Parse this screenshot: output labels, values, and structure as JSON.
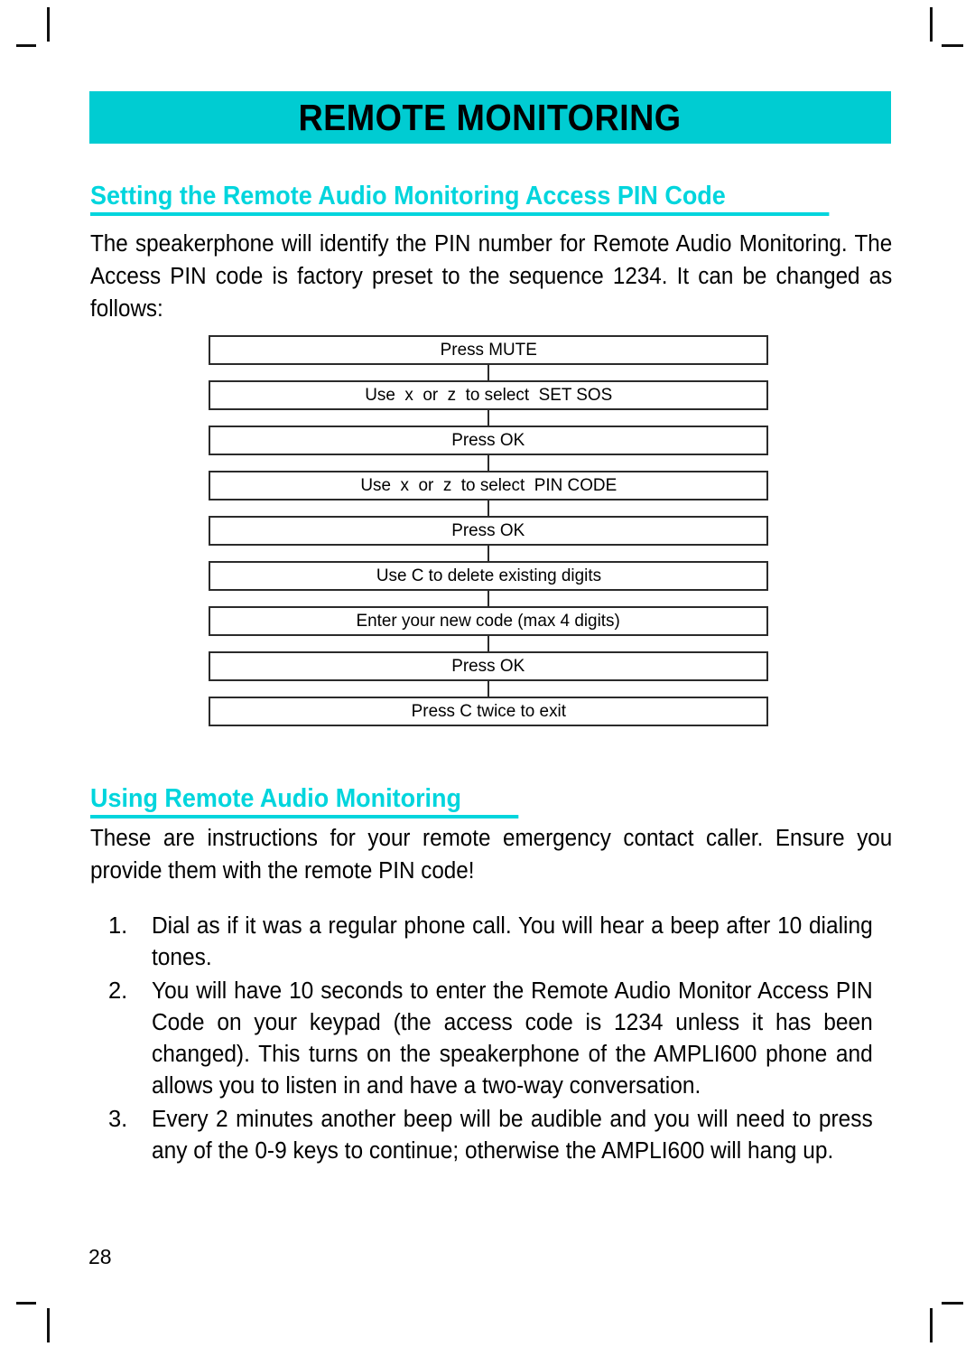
{
  "document": {
    "page_number": "28",
    "banner_title": "REMOTE MONITORING",
    "accent_color": "#00ccd2",
    "heading_color": "#00d5dd"
  },
  "section_1": {
    "heading": "Setting the Remote Audio Monitoring Access PIN Code",
    "paragraph": "The speakerphone will identify the PIN number for Remote Audio Monitoring. The Access PIN code is factory preset to the sequence 1234. It can be changed as follows:",
    "flow_steps": [
      {
        "label": "Press MUTE"
      },
      {
        "label": "Use  x  or  z  to select  SET SOS"
      },
      {
        "label": "Press OK"
      },
      {
        "label": "Use  x  or  z  to select  PIN CODE"
      },
      {
        "label": "Press OK"
      },
      {
        "label": "Use C to delete existing digits"
      },
      {
        "label": "Enter your new code (max 4 digits)"
      },
      {
        "label": "Press OK"
      },
      {
        "label": "Press C twice to exit"
      }
    ]
  },
  "section_2": {
    "heading": "Using Remote Audio Monitoring",
    "paragraph": "These are instructions for your remote emergency contact caller.  Ensure you provide them with the remote PIN code!",
    "numbered_items": [
      {
        "marker": "1.",
        "text": "Dial as if it was a regular phone call. You will hear a  beep  after 10 dialing tones."
      },
      {
        "marker": "2.",
        "text": "You will have 10 seconds to enter the Remote Audio Monitor Access PIN Code on your keypad (the access code is 1234 unless it has been changed). This turns on the speakerphone of the AMPLI600 phone and allows you to listen in and have a two-way conversation."
      },
      {
        "marker": "3.",
        "text": "Every 2 minutes another  beep  will be audible and you will need to press any of the 0-9 keys to continue; otherwise the AMPLI600 will hang up."
      }
    ]
  }
}
